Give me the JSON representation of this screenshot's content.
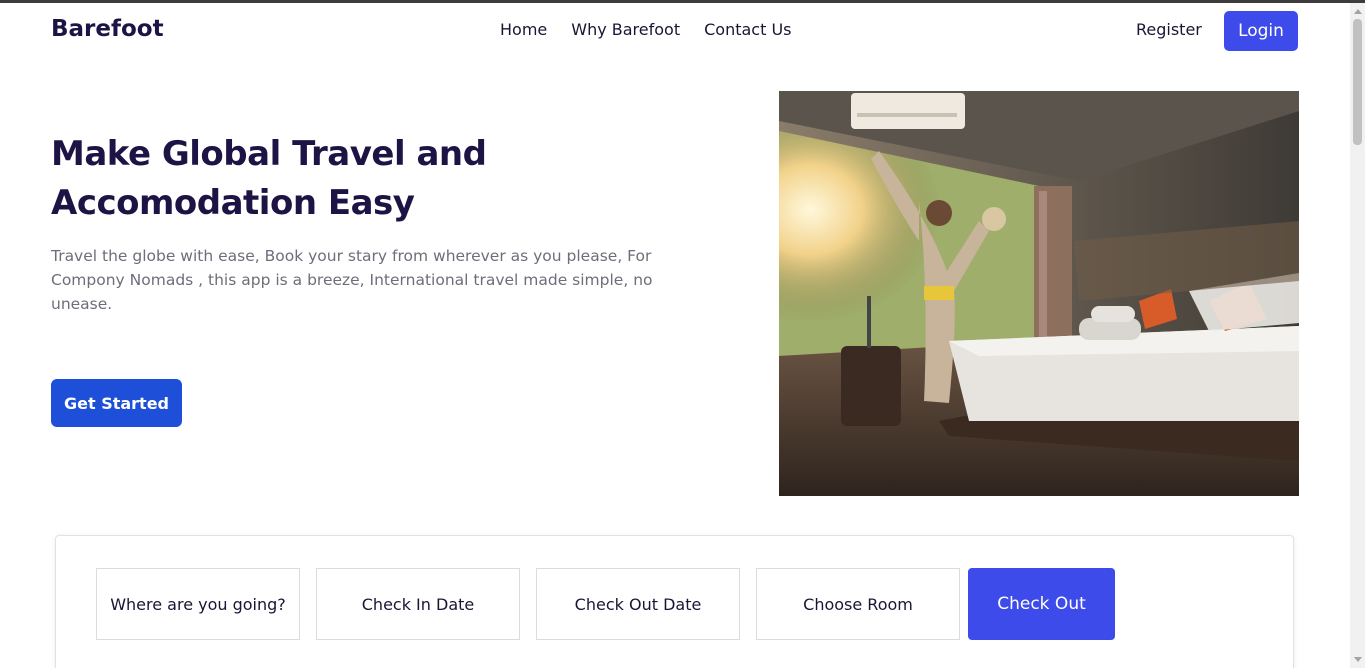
{
  "brand": "Barefoot",
  "nav": {
    "items": [
      "Home",
      "Why Barefoot",
      "Contact Us"
    ],
    "register": "Register",
    "login": "Login"
  },
  "hero": {
    "title_line1": "Make Global Travel and",
    "title_line2": "Accomodation Easy",
    "description": "Travel the globe with ease, Book your stary from wherever as you please, For Compony Nomads , this app is a breeze, International travel made simple, no unease.",
    "cta": "Get Started",
    "image_icon": "hotel-room-photo"
  },
  "search": {
    "destination_placeholder": "Where are you going?",
    "check_in": "Check In Date",
    "check_out_date": "Check Out Date",
    "room": "Choose Room",
    "submit": "Check Out"
  },
  "colors": {
    "brand": "#1d1445",
    "primary": "#3d4bea",
    "cta": "#1d4fd8",
    "muted_text": "#6e6e7a"
  }
}
